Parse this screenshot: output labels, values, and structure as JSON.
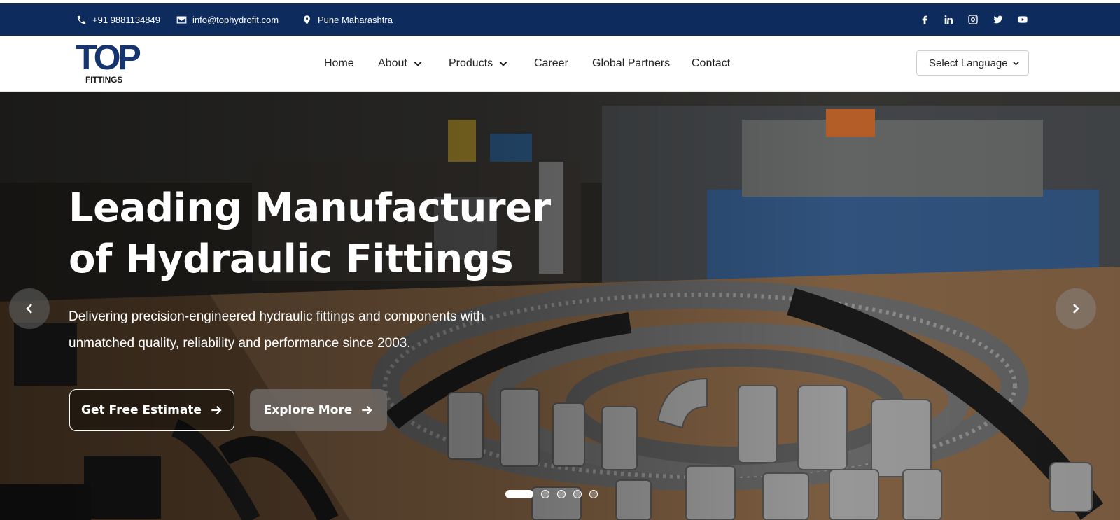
{
  "topbar": {
    "phone": "+91 9881134849",
    "email": "info@tophydrofit.com",
    "location": "Pune Maharashtra",
    "social": [
      "facebook-icon",
      "linkedin-icon",
      "instagram-icon",
      "twitter-icon",
      "youtube-icon"
    ]
  },
  "logo": {
    "letters": "TOP",
    "sub": "FITTINGS"
  },
  "nav": {
    "home": "Home",
    "about": "About",
    "products": "Products",
    "career": "Career",
    "partners": "Global Partners",
    "contact": "Contact",
    "language": "Select Language"
  },
  "hero": {
    "title_line1": "Leading Manufacturer",
    "title_line2": "of Hydraulic Fittings",
    "text_line1": "Delivering precision-engineered hydraulic fittings and components with",
    "text_line2": "unmatched quality, reliability and performance since 2003.",
    "btn_estimate": "Get Free Estimate",
    "btn_explore": "Explore More",
    "slides": 5,
    "active_slide": 1
  },
  "colors": {
    "topbar": "#0d2b5c",
    "logo": "#16356e"
  }
}
